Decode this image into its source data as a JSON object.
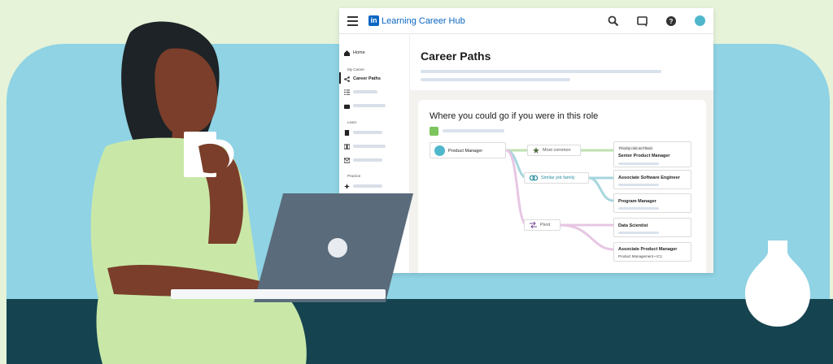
{
  "app": {
    "brand_logo": "in",
    "brand_name": "Learning Career Hub",
    "icons": [
      "hamburger-icon",
      "search-icon",
      "comment-icon",
      "help-icon",
      "avatar"
    ]
  },
  "sidebar": {
    "home": "Home",
    "section_my_career": "My Career",
    "career_paths": "Career Paths",
    "section_learn": "Learn",
    "section_practice": "Practice"
  },
  "main": {
    "page_title": "Career Paths",
    "card_title": "Where you could go if you were in this role"
  },
  "flow": {
    "current_role": "Product Manager",
    "paths": [
      {
        "label": "Most common",
        "icon": "star-icon"
      },
      {
        "label": "Similar job family",
        "icon": "overlap-circles-icon"
      },
      {
        "label": "Pivot",
        "icon": "swap-arrows-icon"
      }
    ],
    "roles": [
      {
        "eyebrow": "Priority role at Flexis",
        "title": "Senior Product Manager"
      },
      {
        "title": "Associate Software Engineer"
      },
      {
        "title": "Program Manager"
      },
      {
        "title": "Data Scientist"
      },
      {
        "title": "Associate Product Manager",
        "subtitle": "Product Management • IC1"
      }
    ]
  },
  "colors": {
    "brand_blue": "#0a66c2",
    "background_blue": "#8fd3e4",
    "background_green": "#e6f3d9",
    "desk": "#15434f",
    "accent_green": "#7cc45c",
    "link_green": "#bfe1b0",
    "link_teal": "#a7d6de",
    "link_pink": "#e7c6e3"
  }
}
